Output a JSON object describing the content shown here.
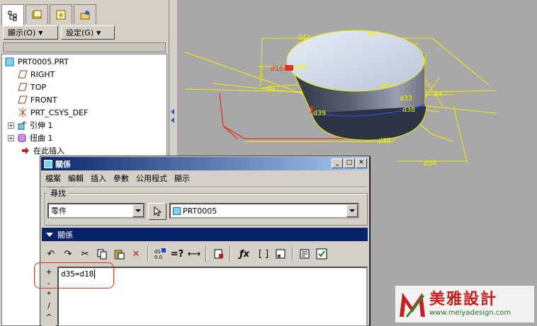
{
  "left_panel": {
    "show_button": "顯示(O)",
    "settings_button": "設定(G)",
    "tree": [
      {
        "label": "PRT0005.PRT",
        "icon": "part-icon"
      },
      {
        "label": "RIGHT",
        "icon": "datum-plane-icon"
      },
      {
        "label": "TOP",
        "icon": "datum-plane-icon"
      },
      {
        "label": "FRONT",
        "icon": "datum-plane-icon"
      },
      {
        "label": "PRT_CSYS_DEF",
        "icon": "csys-icon"
      },
      {
        "label": "引伸 1",
        "icon": "extrude-icon"
      },
      {
        "label": "扭曲 1",
        "icon": "warp-icon"
      },
      {
        "label": "在此插入",
        "icon": "insert-here-icon"
      }
    ]
  },
  "graphics": {
    "dimensions": [
      "d42",
      "d41",
      "d16",
      "d40",
      "d9",
      "d43",
      "d4",
      "d33",
      "d38",
      "d34",
      "d35",
      "d39"
    ]
  },
  "dialog": {
    "title": "關係",
    "menu": [
      "檔案",
      "編輯",
      "插入",
      "參數",
      "公用程式",
      "顯示"
    ],
    "find_label": "尋找",
    "type_select": "零件",
    "model_select": "PRT0005",
    "relations_section": "關係",
    "side_symbols": [
      "+",
      "-",
      "*",
      "/",
      "^"
    ],
    "relation_text": "d35=d18"
  },
  "watermark": {
    "brand": "美雅設計",
    "url": "www.meiyadesign.com"
  },
  "colors": {
    "title_gradient_start": "#0a246a",
    "dimension_yellow": "#f0f000",
    "annotation_red": "#e03020",
    "graphics_background": "#a8a8a8"
  }
}
